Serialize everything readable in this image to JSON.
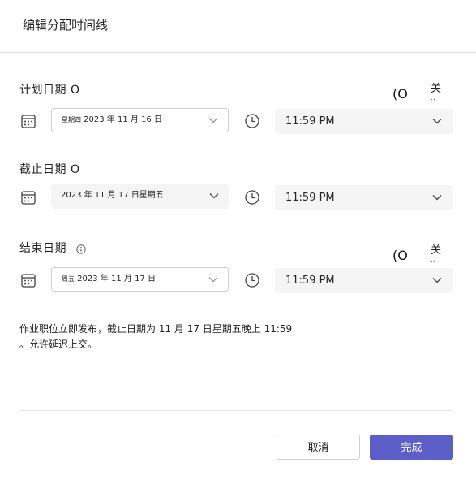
{
  "dialog": {
    "title": "编辑分配时间线"
  },
  "schedule": {
    "label": "计划日期 O",
    "toggle_mark": "(O",
    "toggle_text": "关",
    "toggle_dots": "..",
    "date_weekday": "星期四",
    "date_value": " 2023 年 11 月 16 日",
    "time": "11:59 PM"
  },
  "due": {
    "label": "截止日期 O",
    "date_value": "2023 年 11 月 17 日星期五",
    "time": "11:59 PM"
  },
  "close": {
    "label": "结束日期",
    "info_icon": "info-icon",
    "toggle_mark": "(O",
    "toggle_text": "关",
    "toggle_dots": "..",
    "date_weekday": "周五",
    "date_value": " 2023 年 11 月 17 日",
    "time": "11:59 PM"
  },
  "summary": {
    "line1": "作业职位立即发布，截止日期为 11 月 17 日星期五晚上 11:59",
    "line2": "。允许延迟上交。"
  },
  "footer": {
    "cancel_label": "取消",
    "done_label": "完成"
  },
  "colors": {
    "accent": "#5b5fc7",
    "field_bg": "#f5f5f5",
    "border": "#d1d1d1",
    "text": "#242424"
  },
  "icons": {
    "calendar": "calendar-icon",
    "clock": "clock-icon",
    "chevron": "chevron-down-icon",
    "info": "info-icon"
  }
}
